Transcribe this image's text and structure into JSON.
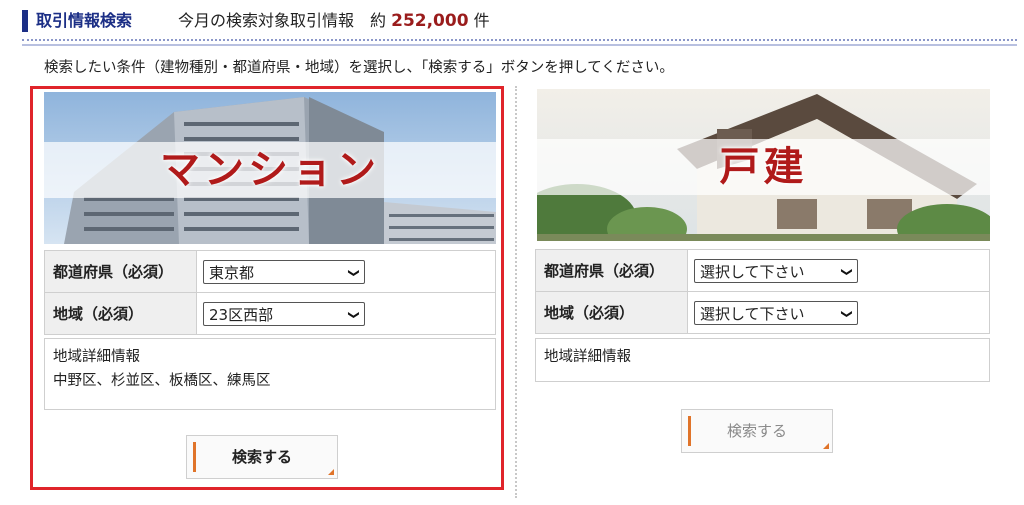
{
  "header": {
    "title": "取引情報検索",
    "subtitle_prefix": "今月の検索対象取引情報　約",
    "count": "252,000",
    "unit": "件"
  },
  "instruction": "検索したい条件（建物種別・都道府県・地域）を選択し、「検索する」ボタンを押してください。",
  "mansion": {
    "title": "マンション",
    "prefecture_label": "都道府県（必須）",
    "prefecture_value": "東京都",
    "region_label": "地域（必須）",
    "region_value": "23区西部",
    "detail_title": "地域詳細情報",
    "detail_text": "中野区、杉並区、板橋区、練馬区",
    "search_button": "検索する"
  },
  "house": {
    "title": "戸建",
    "prefecture_label": "都道府県（必須）",
    "prefecture_value": "選択して下さい",
    "region_label": "地域（必須）",
    "region_value": "選択して下さい",
    "detail_title": "地域詳細情報",
    "search_button": "検索する"
  },
  "colors": {
    "accent_navy": "#1c2f86",
    "count_red": "#9a1c1c",
    "highlight_red": "#e0242a",
    "banner_text": "#b01a1a",
    "button_orange": "#e0742a"
  },
  "icons": {
    "select_arrow": "chevron-down-icon",
    "button_corner": "corner-triangle-icon"
  }
}
